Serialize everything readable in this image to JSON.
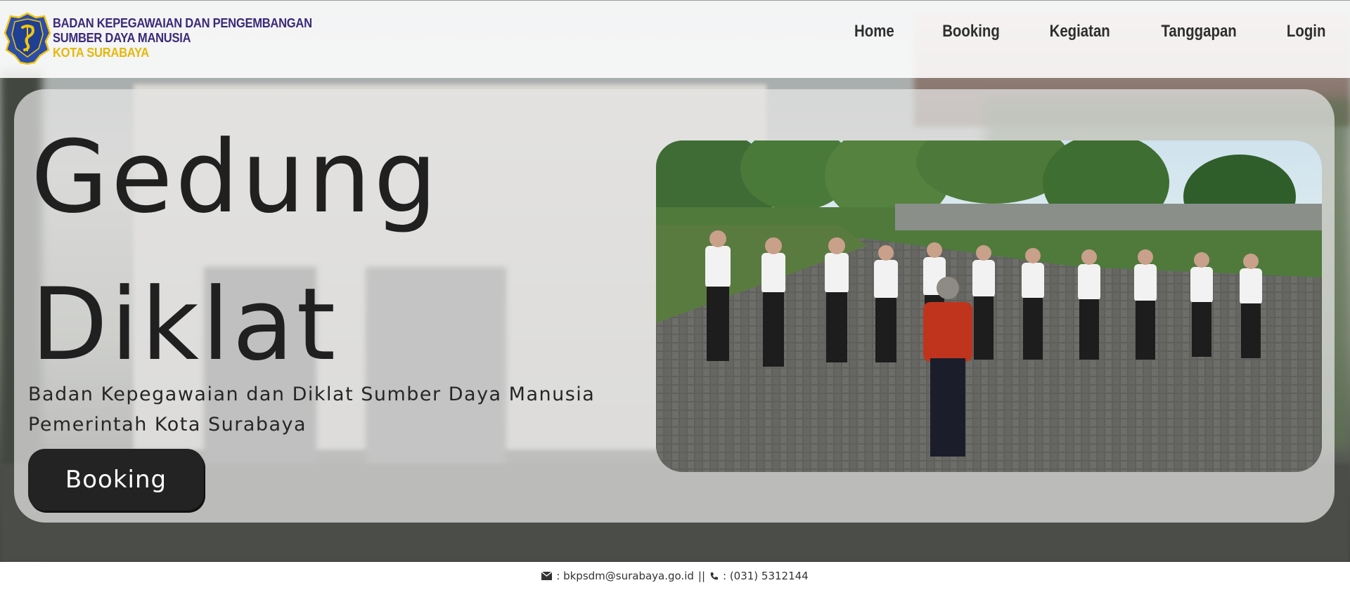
{
  "header": {
    "org_line1": "BADAN KEPEGAWAIAN DAN PENGEMBANGAN",
    "org_line2": "SUMBER DAYA MANUSIA",
    "org_line3": "KOTA SURABAYA",
    "logo_icon": "surabaya-crest-icon"
  },
  "nav": {
    "items": [
      {
        "label": "Home"
      },
      {
        "label": "Booking"
      },
      {
        "label": "Kegiatan"
      },
      {
        "label": "Tanggapan"
      },
      {
        "label": "Login"
      }
    ]
  },
  "hero": {
    "title_line1": "Gedung",
    "title_line2": "Diklat",
    "subtitle": "Badan Kepegawaian dan Diklat Sumber Daya Manusia Pemerintah Kota Surabaya",
    "cta_label": "Booking"
  },
  "footer": {
    "email_icon": "envelope-icon",
    "email_text": ": bkpsdm@surabaya.go.id",
    "separator": "||",
    "phone_icon": "phone-icon",
    "phone_text": ": (031) 5312144"
  },
  "colors": {
    "org_primary": "#3b2a78",
    "org_accent": "#e5b80b",
    "nav_text": "#2e2e2e",
    "cta_bg": "#232323"
  }
}
